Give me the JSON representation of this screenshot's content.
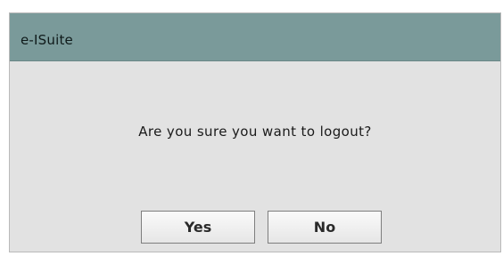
{
  "dialog": {
    "title": "e-ISuite",
    "message": "Are you sure you want to logout?",
    "buttons": {
      "yes_label": "Yes",
      "no_label": "No"
    }
  },
  "colors": {
    "titlebar": "#7a9a9a",
    "dialog_background": "#e2e2e2",
    "button_border": "#7e7e7e"
  }
}
